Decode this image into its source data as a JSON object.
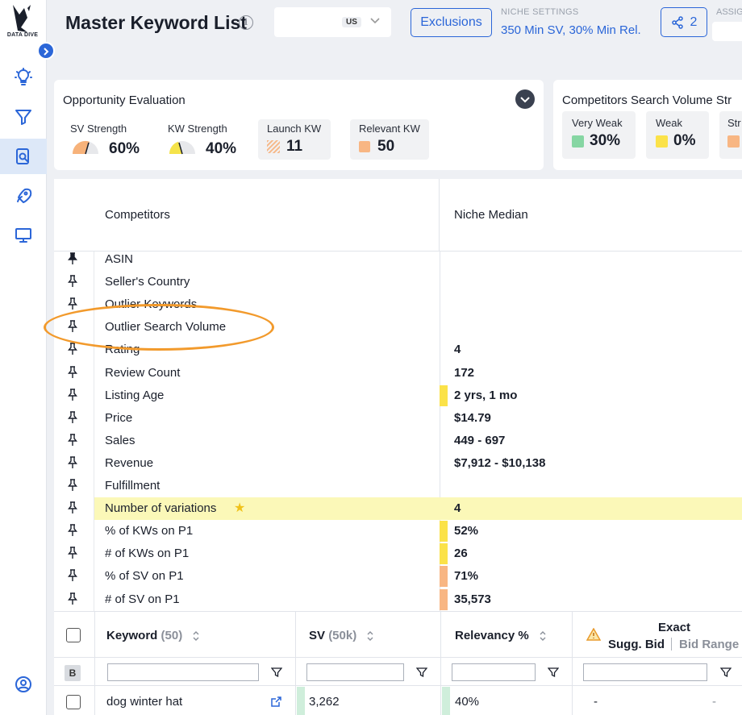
{
  "sidebar": {
    "logo_text": "DATA DIVE",
    "logo_sub": "TOOLS",
    "expand_icon": "chevron-right-icon",
    "nav": [
      {
        "name": "lightbulb-icon"
      },
      {
        "name": "filter-icon"
      },
      {
        "name": "search-doc-icon",
        "active": true
      },
      {
        "name": "rocket-icon"
      },
      {
        "name": "monitor-icon"
      }
    ],
    "bottom_icon": "user-circle-icon"
  },
  "header": {
    "title": "Master Keyword List",
    "market": "US",
    "exclusions_label": "Exclusions",
    "niche_settings_label": "NICHE SETTINGS",
    "niche_settings_value": "350 Min SV, 30% Min Rel.",
    "share_count": "2",
    "assign_label": "ASSIG"
  },
  "opportunity": {
    "title": "Opportunity Evaluation",
    "sv_strength_label": "SV Strength",
    "sv_strength_value": "60%",
    "kw_strength_label": "KW Strength",
    "kw_strength_value": "40%",
    "launch_kw_label": "Launch KW",
    "launch_kw_value": "11",
    "relevant_kw_label": "Relevant KW",
    "relevant_kw_value": "50",
    "colors": {
      "sv": "#f7b27a",
      "kw": "#f5e34a",
      "launch": "#f6b98a",
      "relevant": "#f8b683"
    }
  },
  "competitors_sv": {
    "title": "Competitors Search Volume Str",
    "very_weak_label": "Very Weak",
    "very_weak_value": "30%",
    "weak_label": "Weak",
    "weak_value": "0%",
    "strong_label": "Str",
    "colors": {
      "very_weak": "#86d6a3",
      "weak": "#fbe249",
      "strong": "#f8b683"
    }
  },
  "competitors_table": {
    "left_header": "Competitors",
    "right_header": "Niche Median",
    "rows": [
      {
        "label": "ASIN",
        "value": "",
        "pinned": true
      },
      {
        "label": "Seller's Country",
        "value": ""
      },
      {
        "label": "Outlier Keywords",
        "value": ""
      },
      {
        "label": "Outlier Search Volume",
        "value": ""
      },
      {
        "label": "Rating",
        "value": "4"
      },
      {
        "label": "Review Count",
        "value": "172"
      },
      {
        "label": "Listing Age",
        "value": "2 yrs, 1 mo",
        "bar": "#fbe249"
      },
      {
        "label": "Price",
        "value": "$14.79"
      },
      {
        "label": "Sales",
        "value": "449 - 697"
      },
      {
        "label": "Revenue",
        "value": "$7,912 - $10,138"
      },
      {
        "label": "Fulfillment",
        "value": ""
      },
      {
        "label": "Number of variations",
        "value": "4",
        "highlight": true
      },
      {
        "label": "% of KWs on P1",
        "value": "52%",
        "bar": "#fbe249"
      },
      {
        "label": "# of KWs on P1",
        "value": "26",
        "bar": "#fbe249"
      },
      {
        "label": "% of SV on P1",
        "value": "71%",
        "bar": "#f8b683"
      },
      {
        "label": "# of SV on P1",
        "value": "35,573",
        "bar": "#f8b683"
      }
    ]
  },
  "keyword_table": {
    "col_keyword": "Keyword",
    "col_keyword_count": "(50)",
    "col_sv": "SV",
    "col_sv_count": "(50k)",
    "col_relevancy": "Relevancy %",
    "col_exact": "Exact",
    "col_sugg_bid": "Sugg. Bid",
    "col_bid_range": "Bid Range",
    "b_badge": "B",
    "rows": [
      {
        "keyword": "dog winter hat",
        "sv": "3,262",
        "relevancy": "40%",
        "sugg_bid": "-",
        "bid_range": "-"
      }
    ]
  }
}
